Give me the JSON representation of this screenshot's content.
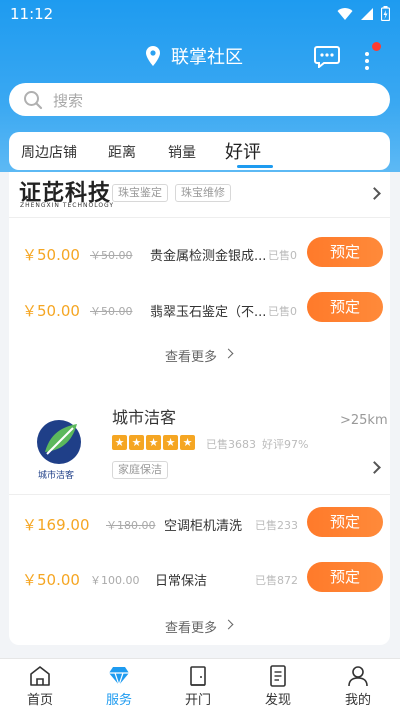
{
  "status_bar": {
    "time": "11:12"
  },
  "header": {
    "title": "联掌社区"
  },
  "search": {
    "placeholder": "搜索"
  },
  "sort_tabs": [
    {
      "label": "周边店铺"
    },
    {
      "label": "距离"
    },
    {
      "label": "销量"
    },
    {
      "label": "好评",
      "active": true
    }
  ],
  "shops": [
    {
      "name": "证芘科技",
      "logo_text": "证芘科技",
      "logo_subtext": "ZHENGXIN TECHNOLOGY",
      "tags": [
        "珠宝鉴定",
        "珠宝维修"
      ],
      "services": [
        {
          "price": "￥50.00",
          "original_price": "￥50.00",
          "name": "贵金属检测金银成...",
          "sold": "已售0",
          "button": "预定"
        },
        {
          "price": "￥50.00",
          "original_price": "￥50.00",
          "name": "翡翠玉石鉴定（不...",
          "sold": "已售0",
          "button": "预定"
        }
      ],
      "see_more": "查看更多"
    },
    {
      "name": "城市洁客",
      "logo_text": "城市洁客",
      "distance": ">25km",
      "rating_stars": 5,
      "sold_stat": "已售3683",
      "good_rate": "好评97%",
      "tags": [
        "家庭保洁"
      ],
      "services": [
        {
          "price": "￥169.00",
          "original_price": "￥180.00",
          "name": "空调柜机清洗",
          "sold": "已售233",
          "button": "预定"
        },
        {
          "price": "￥50.00",
          "original_price": "￥100.00",
          "name": "日常保洁",
          "sold": "已售872",
          "button": "预定"
        }
      ],
      "see_more": "查看更多"
    }
  ],
  "bottom_nav": [
    {
      "label": "首页",
      "icon": "home-icon"
    },
    {
      "label": "服务",
      "icon": "diamond-icon",
      "active": true
    },
    {
      "label": "开门",
      "icon": "door-icon"
    },
    {
      "label": "发现",
      "icon": "document-icon"
    },
    {
      "label": "我的",
      "icon": "person-icon"
    }
  ],
  "colors": {
    "primary": "#1e9bf0",
    "price": "#f5a623",
    "button": "#ff7a2a",
    "badge": "#ff3b30"
  }
}
